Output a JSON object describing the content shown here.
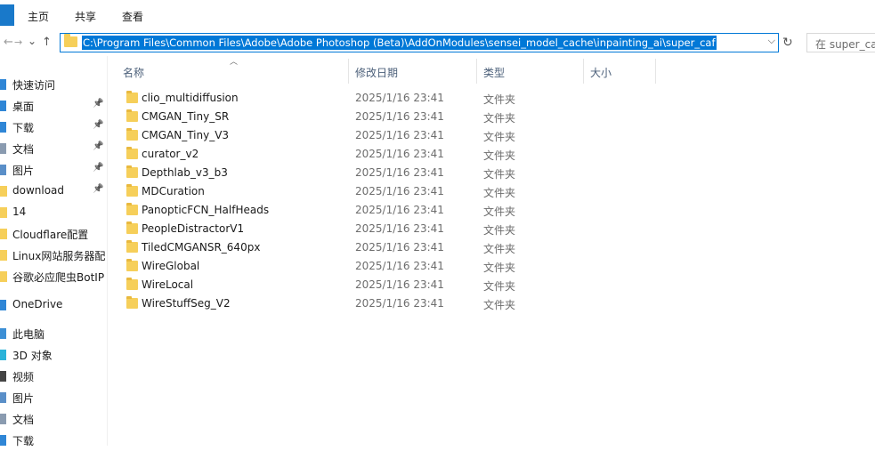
{
  "ribbon": {
    "tabs": [
      "主页",
      "共享",
      "查看"
    ]
  },
  "nav": {
    "back": "←",
    "forward": "→",
    "recent": "⌄",
    "up": "↑"
  },
  "address": {
    "path": "C:\\Program Files\\Common Files\\Adobe\\Adobe Photoshop (Beta)\\AddOnModules\\sensei_model_cache\\inpainting_ai\\super_caf"
  },
  "search": {
    "placeholder": "在 super_ca"
  },
  "sidebar": {
    "items": [
      {
        "label": "快速访问",
        "icon": "star-icon",
        "pinned": false
      },
      {
        "label": "桌面",
        "icon": "desktop-icon",
        "pinned": true
      },
      {
        "label": "下载",
        "icon": "download-icon",
        "pinned": true
      },
      {
        "label": "文档",
        "icon": "document-icon",
        "pinned": true
      },
      {
        "label": "图片",
        "icon": "picture-icon",
        "pinned": true
      },
      {
        "label": "download",
        "icon": "folder-icon",
        "pinned": true
      },
      {
        "label": "14",
        "icon": "folder-icon",
        "pinned": false
      },
      {
        "label": "Cloudflare配置",
        "icon": "folder-icon",
        "pinned": false
      },
      {
        "label": "Linux网站服务器配",
        "icon": "folder-icon",
        "pinned": false
      },
      {
        "label": "谷歌必应爬虫BotIP",
        "icon": "folder-icon",
        "pinned": false
      },
      {
        "label": "OneDrive",
        "icon": "cloud-icon",
        "pinned": false
      },
      {
        "label": "此电脑",
        "icon": "computer-icon",
        "pinned": false
      },
      {
        "label": "3D 对象",
        "icon": "cube-icon",
        "pinned": false
      },
      {
        "label": "视频",
        "icon": "video-icon",
        "pinned": false
      },
      {
        "label": "图片",
        "icon": "picture-icon",
        "pinned": false
      },
      {
        "label": "文档",
        "icon": "document-icon",
        "pinned": false
      },
      {
        "label": "下载",
        "icon": "download-icon",
        "pinned": false
      }
    ]
  },
  "columns": {
    "name": "名称",
    "modified": "修改日期",
    "type": "类型",
    "size": "大小"
  },
  "files": [
    {
      "name": "clio_multidiffusion",
      "date": "2025/1/16 23:41",
      "type": "文件夹"
    },
    {
      "name": "CMGAN_Tiny_SR",
      "date": "2025/1/16 23:41",
      "type": "文件夹"
    },
    {
      "name": "CMGAN_Tiny_V3",
      "date": "2025/1/16 23:41",
      "type": "文件夹"
    },
    {
      "name": "curator_v2",
      "date": "2025/1/16 23:41",
      "type": "文件夹"
    },
    {
      "name": "Depthlab_v3_b3",
      "date": "2025/1/16 23:41",
      "type": "文件夹"
    },
    {
      "name": "MDCuration",
      "date": "2025/1/16 23:41",
      "type": "文件夹"
    },
    {
      "name": "PanopticFCN_HalfHeads",
      "date": "2025/1/16 23:41",
      "type": "文件夹"
    },
    {
      "name": "PeopleDistractorV1",
      "date": "2025/1/16 23:41",
      "type": "文件夹"
    },
    {
      "name": "TiledCMGANSR_640px",
      "date": "2025/1/16 23:41",
      "type": "文件夹"
    },
    {
      "name": "WireGlobal",
      "date": "2025/1/16 23:41",
      "type": "文件夹"
    },
    {
      "name": "WireLocal",
      "date": "2025/1/16 23:41",
      "type": "文件夹"
    },
    {
      "name": "WireStuffSeg_V2",
      "date": "2025/1/16 23:41",
      "type": "文件夹"
    }
  ],
  "colors": {
    "accent": "#0078d7",
    "folder": "#f6cf5a",
    "file_tab": "#1979ca"
  }
}
